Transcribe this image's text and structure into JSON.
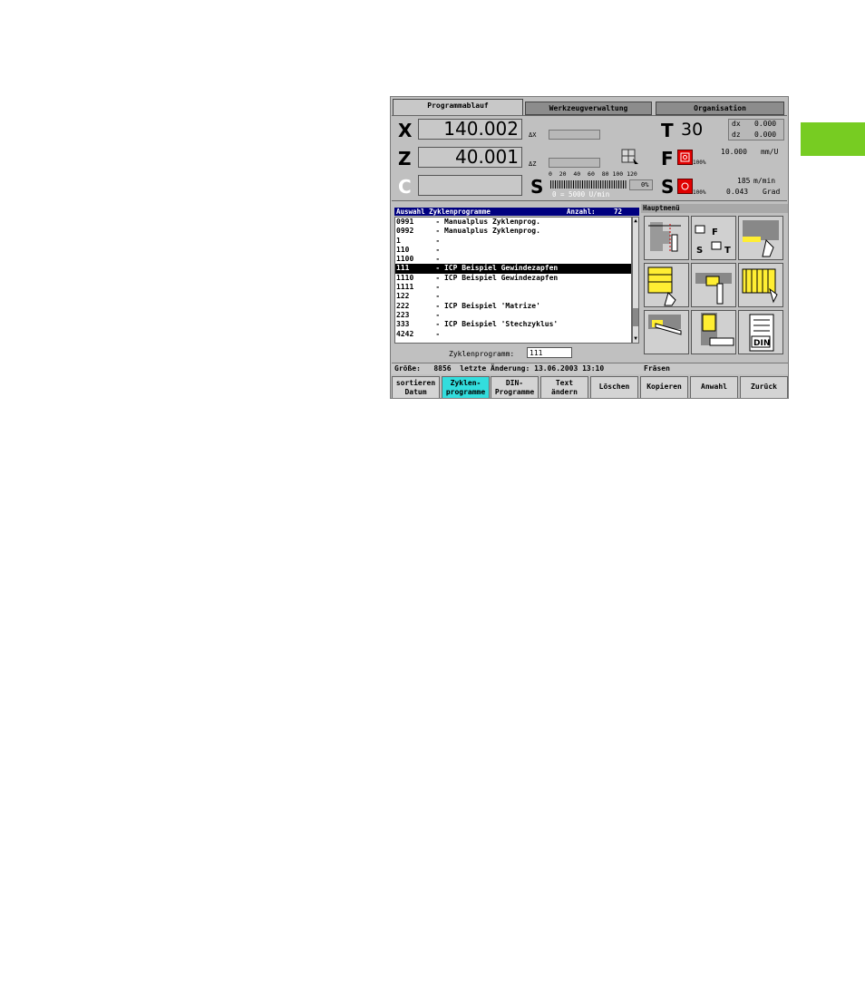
{
  "tabs": [
    {
      "label": "Programmablauf",
      "active": true
    },
    {
      "label": "Werkzeugverwaltung",
      "active": false
    },
    {
      "label": "Organisation",
      "active": false
    }
  ],
  "positions": {
    "x_label": "X",
    "x_value": "140.002",
    "z_label": "Z",
    "z_value": "40.001",
    "c_label": "C",
    "c_value": "",
    "dx_label": "ΔX",
    "dz_label": "ΔZ"
  },
  "tool": {
    "t_label": "T",
    "t_value": "30",
    "dx_label": "dx",
    "dx_value": "0.000",
    "dz_label": "dz",
    "dz_value": "0.000"
  },
  "feed": {
    "label": "F",
    "value": "10.000",
    "unit": "mm/U",
    "override": "100%"
  },
  "spindle": {
    "label": "S",
    "scale": "0  20  40  60  80 100 120",
    "percent": "0%",
    "speed_text": "0 = 5000 U/min",
    "s1_label": "S",
    "s1_value": "185",
    "s1_unit": "m/min",
    "s1_override": "100%",
    "s1_angle": "0.043",
    "s1_angle_unit": "Grad"
  },
  "list": {
    "title": "Auswahl Zyklenprogramme",
    "count_label": "Anzahl:",
    "count": "72",
    "items": [
      {
        "text": "0991     - Manualplus Zyklenprog.",
        "selected": false
      },
      {
        "text": "0992     - Manualplus Zyklenprog.",
        "selected": false
      },
      {
        "text": "1        -",
        "selected": false
      },
      {
        "text": "110      -",
        "selected": false
      },
      {
        "text": "1100     -",
        "selected": false
      },
      {
        "text": "111      - ICP Beispiel Gewindezapfen",
        "selected": true
      },
      {
        "text": "1110     - ICP Beispiel Gewindezapfen",
        "selected": false
      },
      {
        "text": "1111     -",
        "selected": false
      },
      {
        "text": "122      -",
        "selected": false
      },
      {
        "text": "222      - ICP Beispiel 'Matrize'",
        "selected": false
      },
      {
        "text": "223      -",
        "selected": false
      },
      {
        "text": "333      - ICP Beispiel 'Stechzyklus'",
        "selected": false
      },
      {
        "text": "4242     -",
        "selected": false
      }
    ],
    "program_label": "Zyklenprogramm:",
    "program_value": "111"
  },
  "status": {
    "text": "Größe:   8856  letzte Änderung: 13.06.2003 13:10"
  },
  "menu": {
    "title": "Hauptmenü",
    "icons": [
      "turning-icon",
      "sft-icon",
      "roughing-icon",
      "facing-icon",
      "recessing-icon",
      "thread-icon",
      "drilling-icon",
      "milling-icon",
      "din-icon"
    ],
    "din_text": "DIN",
    "s_text": "S",
    "t_text": "T",
    "f_text": "F",
    "status_text": "Fräsen"
  },
  "softkeys": [
    {
      "line1": "sortieren",
      "line2": "Datum",
      "active": false
    },
    {
      "line1": "Zyklen-",
      "line2": "programme",
      "active": true
    },
    {
      "line1": "DIN-",
      "line2": "Programme",
      "active": false
    },
    {
      "line1": "Text",
      "line2": "ändern",
      "active": false
    },
    {
      "line1": "Löschen",
      "line2": "",
      "active": false
    },
    {
      "line1": "Kopieren",
      "line2": "",
      "active": false
    },
    {
      "line1": "Anwahl",
      "line2": "",
      "active": false
    },
    {
      "line1": "Zurück",
      "line2": "",
      "active": false
    }
  ],
  "colors": {
    "accent_green": "#77cc22",
    "list_header": "#000080",
    "active_softkey": "#33dddd",
    "red": "#e00000"
  }
}
